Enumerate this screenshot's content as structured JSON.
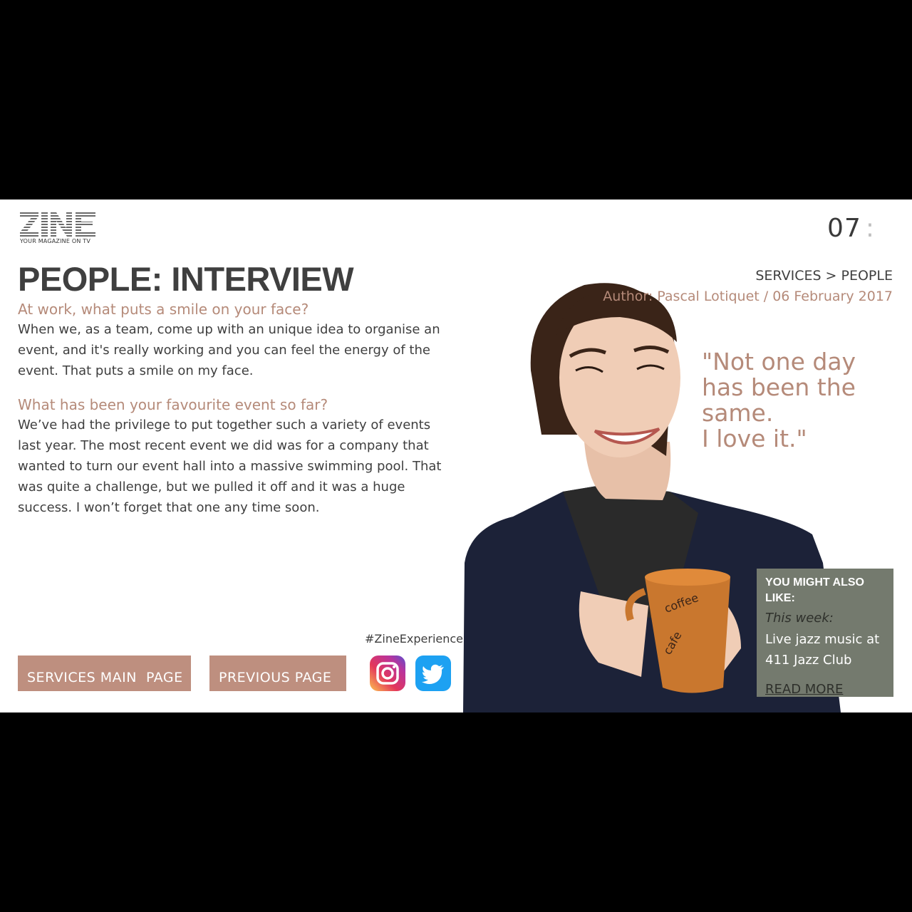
{
  "logo": {
    "wordmark": "ZINE",
    "tagline": "YOUR MAGAZINE ON TV"
  },
  "clock": {
    "hours": "07",
    "separator": ":"
  },
  "page_title": "PEOPLE: INTERVIEW",
  "breadcrumb": "SERVICES > PEOPLE",
  "author": "Author: Pascal Lotiquet / 06 February 2017",
  "article": {
    "q1": "At work, what puts a smile on your face?",
    "a1": "When we, as a team, come up with an unique idea to organise an event, and it's really working and you can feel the energy of the event. That puts a smile on my face.",
    "q2": "What has been your favourite event so far?",
    "a2": "We’ve had the privilege to put together such a variety of events last year. The most recent event we did was for a company that wanted to turn our event hall into a massive swimming pool. That was quite a challenge, but we pulled it off and it was a huge success. I won’t forget that one any time soon."
  },
  "quote": "\"Not one day\nhas been the\nsame.\nI love it.\"",
  "buttons": {
    "services": "SERVICES MAIN  PAGE",
    "previous": "PREVIOUS PAGE"
  },
  "social": {
    "hashtag": "#ZineExperience",
    "icons": [
      "instagram-icon",
      "twitter-icon"
    ]
  },
  "promo": {
    "title": "YOU MIGHT ALSO LIKE:",
    "week": "This week:",
    "text": "Live jazz music at 411 Jazz Club",
    "link": "READ MORE"
  },
  "colors": {
    "accent": "#be8f7f",
    "accent_text": "#b58a79",
    "heading": "#3f3f3f",
    "promo_bg": "#747a6e",
    "letterbox": "#000000"
  }
}
